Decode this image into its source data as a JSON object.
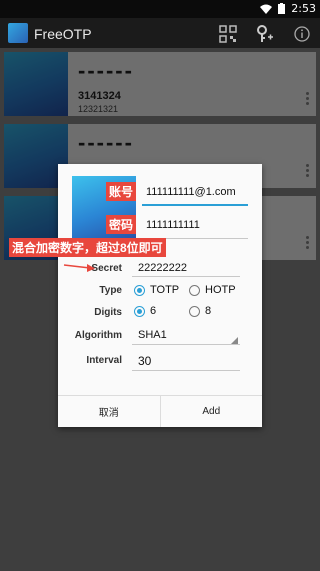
{
  "status_bar": {
    "time": "2:53"
  },
  "app_bar": {
    "title": "FreeOTP"
  },
  "tokens": [
    {
      "code": "------",
      "issuer": "3141324",
      "account": "12321321"
    },
    {
      "code": "------",
      "issuer": "",
      "account": ""
    },
    {
      "code": "",
      "issuer": "",
      "account": ""
    }
  ],
  "dialog": {
    "issuer_value": "111111111@1.com",
    "id_value": "1111111111",
    "secret_label": "Secret",
    "secret_value": "22222222",
    "type_label": "Type",
    "type_options": [
      "TOTP",
      "HOTP"
    ],
    "type_selected": "TOTP",
    "digits_label": "Digits",
    "digits_options": [
      "6",
      "8"
    ],
    "digits_selected": "6",
    "algorithm_label": "Algorithm",
    "algorithm_value": "SHA1",
    "interval_label": "Interval",
    "interval_value": "30",
    "cancel_label": "取消",
    "add_label": "Add"
  },
  "annotations": {
    "account": "账号",
    "password": "密码",
    "secret_hint": "混合加密数字，超过8位即可"
  },
  "colors": {
    "accent": "#2a9fd6",
    "annotation": "#e8473d",
    "icon_gradient": [
      "#35b8e8",
      "#264fa8"
    ]
  }
}
